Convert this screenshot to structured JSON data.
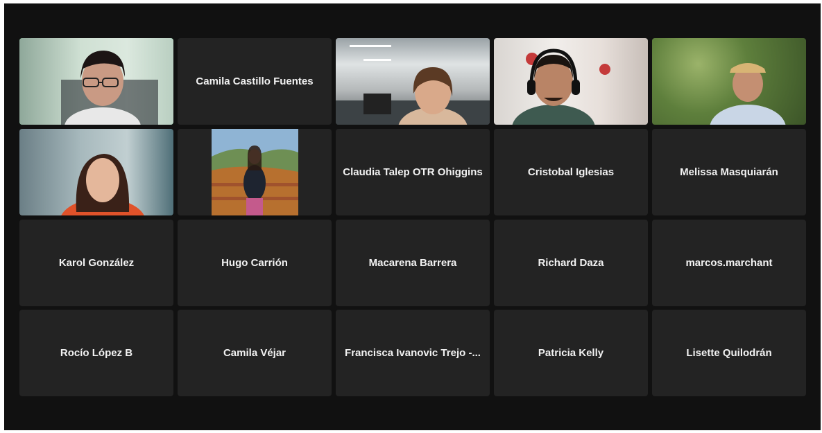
{
  "participants": [
    {
      "name": "",
      "video": "woman-glasses-office",
      "speaking": true
    },
    {
      "name": "Camila Castillo Fuentes"
    },
    {
      "name": "",
      "video": "woman-headset-openoffice"
    },
    {
      "name": "",
      "video": "man-headset"
    },
    {
      "name": "",
      "video": "older-man-cap-outdoors"
    },
    {
      "name": "",
      "video": "young-woman-red-top"
    },
    {
      "name": "",
      "video": "woman-mountain-photo"
    },
    {
      "name": "Claudia Talep OTR Ohiggins"
    },
    {
      "name": "Cristobal Iglesias"
    },
    {
      "name": "Melissa Masquiarán"
    },
    {
      "name": "Karol González"
    },
    {
      "name": "Hugo Carrión"
    },
    {
      "name": "Macarena Barrera"
    },
    {
      "name": "Richard Daza"
    },
    {
      "name": "marcos.marchant"
    },
    {
      "name": "Rocío López B"
    },
    {
      "name": "Camila Véjar"
    },
    {
      "name": "Francisca Ivanovic Trejo -..."
    },
    {
      "name": "Patricia Kelly"
    },
    {
      "name": "Lisette Quilodrán"
    }
  ],
  "colors": {
    "stage": "#111111",
    "tile": "#232323",
    "active_speaker_border": "#22c55e",
    "name_text": "#f2f2f2"
  }
}
